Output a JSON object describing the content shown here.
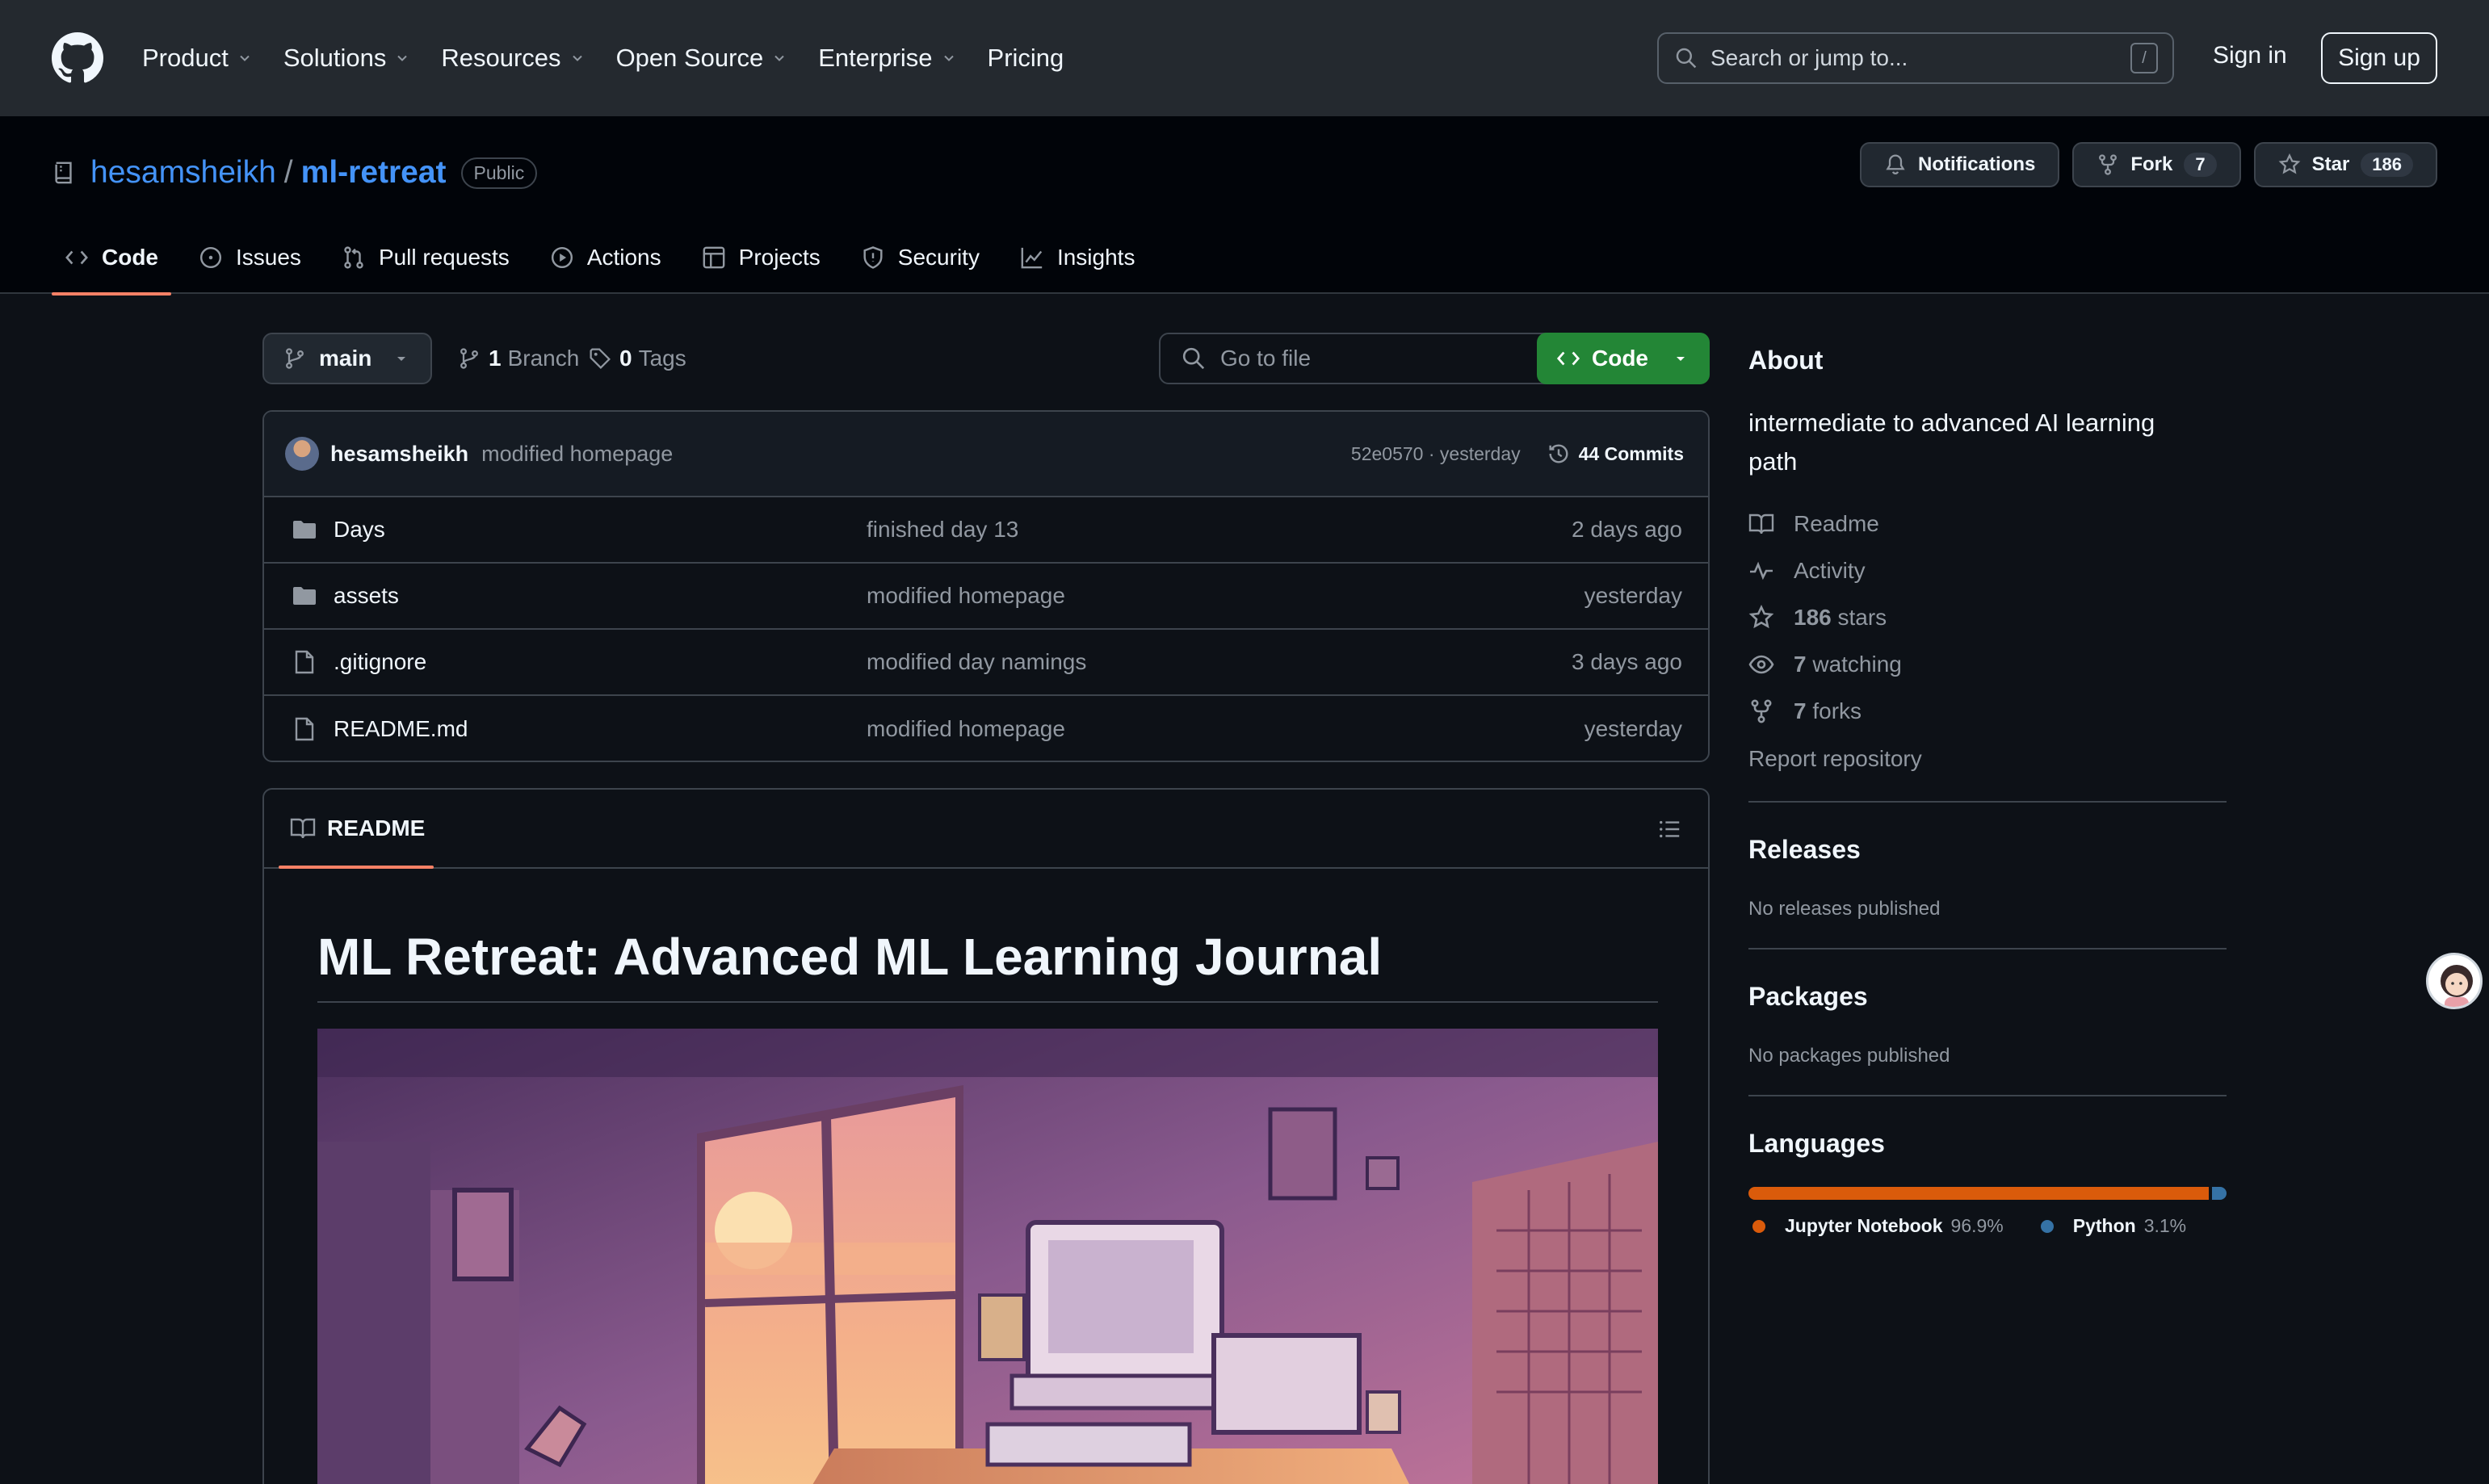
{
  "header": {
    "nav": [
      "Product",
      "Solutions",
      "Resources",
      "Open Source",
      "Enterprise",
      "Pricing"
    ],
    "search_placeholder": "Search or jump to...",
    "search_shortcut": "/",
    "sign_in": "Sign in",
    "sign_up": "Sign up"
  },
  "repo": {
    "owner": "hesamsheikh",
    "separator": "/",
    "name": "ml-retreat",
    "visibility": "Public",
    "actions": {
      "notifications": "Notifications",
      "fork_label": "Fork",
      "fork_count": "7",
      "star_label": "Star",
      "star_count": "186"
    },
    "tabs": [
      "Code",
      "Issues",
      "Pull requests",
      "Actions",
      "Projects",
      "Security",
      "Insights"
    ],
    "active_tab": "Code"
  },
  "toolbar": {
    "branch": "main",
    "branches_count": "1",
    "branches_label": "Branch",
    "tags_count": "0",
    "tags_label": "Tags",
    "go_to_file": "Go to file",
    "code_button": "Code"
  },
  "commit": {
    "author": "hesamsheikh",
    "message": "modified homepage",
    "hash_time": "52e0570 · yesterday",
    "commits": "44 Commits"
  },
  "files": [
    {
      "type": "folder",
      "name": "Days",
      "message": "finished day 13",
      "time": "2 days ago"
    },
    {
      "type": "folder",
      "name": "assets",
      "message": "modified homepage",
      "time": "yesterday"
    },
    {
      "type": "file",
      "name": ".gitignore",
      "message": "modified day namings",
      "time": "3 days ago"
    },
    {
      "type": "file",
      "name": "README.md",
      "message": "modified homepage",
      "time": "yesterday"
    }
  ],
  "readme": {
    "tab_label": "README",
    "title": "ML Retreat: Advanced ML Learning Journal"
  },
  "about": {
    "title": "About",
    "description": "intermediate to advanced AI learning path",
    "links": [
      {
        "icon": "book-icon",
        "text": "Readme"
      },
      {
        "icon": "pulse-icon",
        "text": "Activity"
      },
      {
        "icon": "star-icon",
        "count": "186",
        "text": "stars"
      },
      {
        "icon": "eye-icon",
        "count": "7",
        "text": "watching"
      },
      {
        "icon": "fork-icon",
        "count": "7",
        "text": "forks"
      }
    ],
    "report": "Report repository"
  },
  "releases": {
    "title": "Releases",
    "empty": "No releases published"
  },
  "packages": {
    "title": "Packages",
    "empty": "No packages published"
  },
  "languages": {
    "title": "Languages",
    "items": [
      {
        "name": "Jupyter Notebook",
        "percent": "96.9%",
        "value": 96.9,
        "color": "#DA5B0B"
      },
      {
        "name": "Python",
        "percent": "3.1%",
        "value": 3.1,
        "color": "#3572A5"
      }
    ]
  }
}
